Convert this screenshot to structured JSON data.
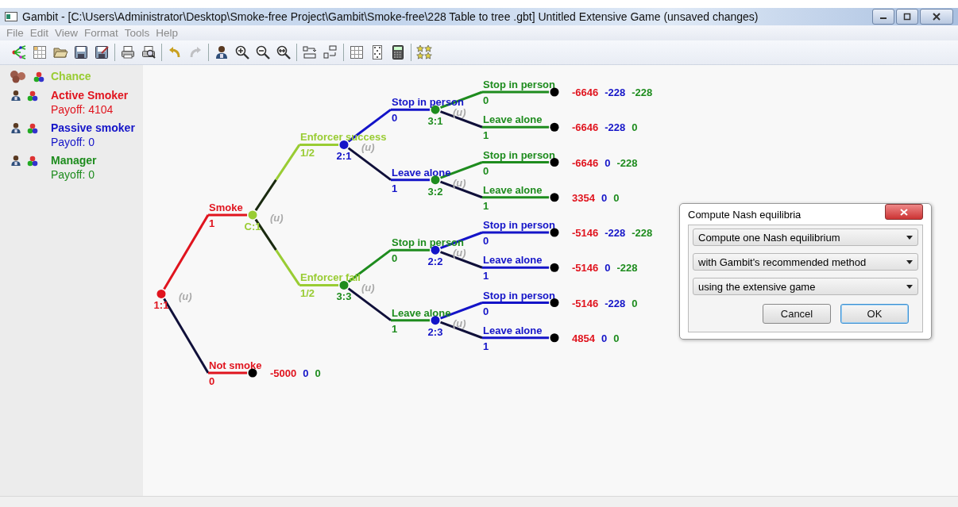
{
  "window": {
    "title": "Gambit - [C:\\Users\\Administrator\\Desktop\\Smoke-free Project\\Gambit\\Smoke-free\\228 Table to tree .gbt] Untitled Extensive Game (unsaved changes)"
  },
  "menu": [
    {
      "label": "File",
      "disabled": true
    },
    {
      "label": "Edit",
      "disabled": true
    },
    {
      "label": "View",
      "disabled": true
    },
    {
      "label": "Format",
      "disabled": true
    },
    {
      "label": "Tools",
      "disabled": true
    },
    {
      "label": "Help",
      "disabled": true
    }
  ],
  "toolbar": [
    [
      {
        "kind": "tree",
        "disabled": false
      },
      {
        "kind": "table",
        "disabled": false
      },
      {
        "kind": "open",
        "disabled": false
      },
      {
        "kind": "save",
        "disabled": false
      },
      {
        "kind": "save-as",
        "disabled": false
      }
    ],
    [
      {
        "kind": "print",
        "disabled": false
      },
      {
        "kind": "preview",
        "disabled": false
      }
    ],
    [
      {
        "kind": "undo",
        "disabled": false
      },
      {
        "kind": "redo",
        "disabled": true
      }
    ],
    [
      {
        "kind": "player",
        "disabled": false
      },
      {
        "kind": "zoom-in",
        "disabled": false
      },
      {
        "kind": "zoom-out",
        "disabled": false
      },
      {
        "kind": "zoom-fit",
        "disabled": false
      }
    ],
    [
      {
        "kind": "decimal",
        "disabled": false
      },
      {
        "kind": "rational",
        "disabled": false
      }
    ],
    [
      {
        "kind": "grid",
        "disabled": false
      },
      {
        "kind": "dots",
        "disabled": false
      },
      {
        "kind": "calculator",
        "disabled": false
      }
    ],
    [
      {
        "kind": "stars",
        "disabled": false
      }
    ]
  ],
  "players": [
    {
      "kind": "chance",
      "name": "Chance",
      "color": "#99cc33"
    },
    {
      "kind": "player",
      "name": "Active Smoker",
      "payoff": "Payoff: 4104",
      "color": "#e0141e"
    },
    {
      "kind": "player",
      "name": "Passive smoker",
      "payoff": "Payoff: 0",
      "color": "#1414c8"
    },
    {
      "kind": "player",
      "name": "Manager",
      "payoff": "Payoff: 0",
      "color": "#1e8c1e"
    }
  ],
  "tree": {
    "kind": "decision",
    "color": "#e0141e",
    "label": "1:1",
    "info": "(u)",
    "branches": [
      {
        "label": "Smoke",
        "value": "1",
        "node": {
          "kind": "chance",
          "color": "#99cc33",
          "label": "C:1",
          "info": "(u)",
          "branches": [
            {
              "label": "Enforcer success",
              "value": "1/2",
              "node": {
                "kind": "decision",
                "color": "#1414c8",
                "label": "2:1",
                "info": "(u)",
                "branches": [
                  {
                    "label": "Stop in person",
                    "value": "0",
                    "node": {
                      "kind": "decision",
                      "color": "#1e8c1e",
                      "label": "3:1",
                      "info": "(u)",
                      "branches": [
                        {
                          "label": "Stop in person",
                          "value": "0",
                          "node": {
                            "payoffs": [
                              "-6646",
                              "-228",
                              "-228"
                            ]
                          }
                        },
                        {
                          "label": "Leave alone",
                          "value": "1",
                          "node": {
                            "payoffs": [
                              "-6646",
                              "-228",
                              "0"
                            ]
                          }
                        }
                      ]
                    }
                  },
                  {
                    "label": "Leave alone",
                    "value": "1",
                    "node": {
                      "kind": "decision",
                      "color": "#1e8c1e",
                      "label": "3:2",
                      "info": "(u)",
                      "branches": [
                        {
                          "label": "Stop in person",
                          "value": "0",
                          "node": {
                            "payoffs": [
                              "-6646",
                              "0",
                              "-228"
                            ]
                          }
                        },
                        {
                          "label": "Leave alone",
                          "value": "1",
                          "node": {
                            "payoffs": [
                              "3354",
                              "0",
                              "0"
                            ]
                          }
                        }
                      ]
                    }
                  }
                ]
              }
            },
            {
              "label": "Enforcer fail",
              "value": "1/2",
              "node": {
                "kind": "decision",
                "color": "#1e8c1e",
                "label": "3:3",
                "info": "(u)",
                "branches": [
                  {
                    "label": "Stop in person",
                    "value": "0",
                    "node": {
                      "kind": "decision",
                      "color": "#1414c8",
                      "label": "2:2",
                      "info": "(u)",
                      "branches": [
                        {
                          "label": "Stop in person",
                          "value": "0",
                          "node": {
                            "payoffs": [
                              "-5146",
                              "-228",
                              "-228"
                            ]
                          }
                        },
                        {
                          "label": "Leave alone",
                          "value": "1",
                          "node": {
                            "payoffs": [
                              "-5146",
                              "0",
                              "-228"
                            ]
                          }
                        }
                      ]
                    }
                  },
                  {
                    "label": "Leave alone",
                    "value": "1",
                    "node": {
                      "kind": "decision",
                      "color": "#1414c8",
                      "label": "2:3",
                      "info": "(u)",
                      "branches": [
                        {
                          "label": "Stop in person",
                          "value": "0",
                          "node": {
                            "payoffs": [
                              "-5146",
                              "-228",
                              "0"
                            ]
                          }
                        },
                        {
                          "label": "Leave alone",
                          "value": "1",
                          "node": {
                            "payoffs": [
                              "4854",
                              "0",
                              "0"
                            ]
                          }
                        }
                      ]
                    }
                  }
                ]
              }
            }
          ]
        }
      },
      {
        "label": "Not smoke",
        "value": "0",
        "node": {
          "payoffs": [
            "-5000",
            "0",
            "0"
          ]
        }
      }
    ]
  },
  "dialog": {
    "title": "Compute Nash equilibria",
    "selects": [
      "Compute one Nash equilibrium",
      "with Gambit's recommended method",
      "using the extensive game"
    ],
    "buttons": [
      {
        "label": "Cancel",
        "default": false
      },
      {
        "label": "OK",
        "default": true
      }
    ]
  }
}
